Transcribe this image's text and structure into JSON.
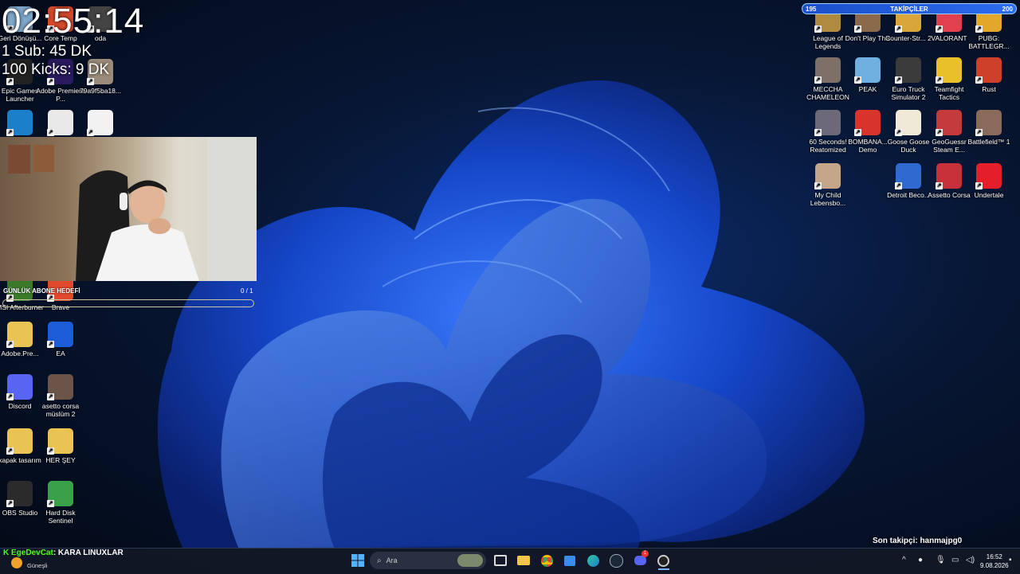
{
  "overlay": {
    "timer": "02:55:14",
    "goal_sub": "1 Sub: 45 DK",
    "goal_kicks": "100 Kicks: 9 DK",
    "goal_bar_label": "GÜNLÜK ABONE HEDEFİ",
    "goal_bar_count": "0 / 1",
    "follow_bar": {
      "left_value": "195",
      "title": "TAKİPÇİLER",
      "right_value": "200"
    },
    "last_follower": "Son takipçi: hanmajpg0"
  },
  "desktop_left": [
    {
      "label": "Geri Dönüşü...",
      "icon": "recycle-bin-icon",
      "color": "#7fa7c9"
    },
    {
      "label": "Core Temp",
      "icon": "core-temp-icon",
      "color": "#d64a2b"
    },
    {
      "label": "oda",
      "icon": "folder-icon",
      "color": "#444"
    },
    {
      "label": "Epic Games Launcher",
      "icon": "epic-games-icon",
      "color": "#222"
    },
    {
      "label": "Adobe Premiere P...",
      "icon": "premiere-icon",
      "color": "#2a1a5e"
    },
    {
      "label": "79a9f5ba18...",
      "icon": "image-file-icon",
      "color": "#9b8c7a"
    },
    {
      "label": "",
      "icon": "edge-icon",
      "color": "#1c7fc9"
    },
    {
      "label": "",
      "icon": "obs-like-icon",
      "color": "#e9e9e9"
    },
    {
      "label": "",
      "icon": "file-icon",
      "color": "#f2f2f2"
    },
    {
      "label": "MSI Afterburner",
      "icon": "msi-afterburner-icon",
      "color": "#3a7a2a"
    },
    {
      "label": "Brave",
      "icon": "brave-icon",
      "color": "#e0492b"
    },
    {
      "label": "Adobe.Pre...",
      "icon": "folder-icon",
      "color": "#e9c354"
    },
    {
      "label": "EA",
      "icon": "ea-icon",
      "color": "#1d5cd8"
    },
    {
      "label": "Discord",
      "icon": "discord-icon",
      "color": "#5865f2"
    },
    {
      "label": "asetto corsa müslüm 2",
      "icon": "image-file-icon",
      "color": "#6a5548"
    },
    {
      "label": "kapak tasarım",
      "icon": "folder-icon",
      "color": "#e9c354"
    },
    {
      "label": "HER ŞEY",
      "icon": "folder-icon",
      "color": "#e9c354"
    },
    {
      "label": "OBS Studio",
      "icon": "obs-studio-icon",
      "color": "#2b2b2b"
    },
    {
      "label": "Hard Disk Sentinel",
      "icon": "hdd-sentinel-icon",
      "color": "#3aa04a"
    }
  ],
  "desktop_right": [
    {
      "label": "League of Legends",
      "icon": "lol-icon",
      "color": "#b08a3e"
    },
    {
      "label": "Don't Play This",
      "icon": "game-icon",
      "color": "#8a6a4a"
    },
    {
      "label": "Counter-Str... 2",
      "icon": "cs2-icon",
      "color": "#d9a63a"
    },
    {
      "label": "VALORANT",
      "icon": "valorant-icon",
      "color": "#e2404f"
    },
    {
      "label": "PUBG: BATTLEGR...",
      "icon": "pubg-icon",
      "color": "#e3a72c"
    },
    {
      "label": "MECCHA CHAMELEON",
      "icon": "game-icon",
      "color": "#7c7068"
    },
    {
      "label": "PEAK",
      "icon": "peak-icon",
      "color": "#6fb0e0"
    },
    {
      "label": "Euro Truck Simulator 2",
      "icon": "ets2-icon",
      "color": "#3b3b3b"
    },
    {
      "label": "Teamfight Tactics",
      "icon": "tft-icon",
      "color": "#e8c12a"
    },
    {
      "label": "Rust",
      "icon": "rust-icon",
      "color": "#cd412b"
    },
    {
      "label": "60 Seconds! Reatomized",
      "icon": "game-icon",
      "color": "#6c6a78"
    },
    {
      "label": "BOMBANA... Demo",
      "icon": "game-icon",
      "color": "#d8342b"
    },
    {
      "label": "Goose Goose Duck",
      "icon": "ggd-icon",
      "color": "#f1e9d8"
    },
    {
      "label": "GeoGuessr Steam E...",
      "icon": "geoguessr-icon",
      "color": "#c53a3a"
    },
    {
      "label": "Battlefield™ 1",
      "icon": "bf1-icon",
      "color": "#8a6a5a"
    },
    {
      "label": "My Child Lebensbo...",
      "icon": "game-icon",
      "color": "#c6a68a"
    },
    {
      "label": "Detroit Beco...",
      "icon": "detroit-icon",
      "color": "#2f6ad0"
    },
    {
      "label": "Assetto Corsa",
      "icon": "assetto-corsa-icon",
      "color": "#c8303a"
    },
    {
      "label": "Undertale",
      "icon": "undertale-icon",
      "color": "#e3202a"
    }
  ],
  "taskbar": {
    "chat_user": "EgeDevCat",
    "chat_message": ": KARA LINUXLAR",
    "weather": "Güneşli",
    "search_placeholder": "Ara",
    "time": "16:52",
    "date": "9.08.2026",
    "discord_badge": "1"
  }
}
